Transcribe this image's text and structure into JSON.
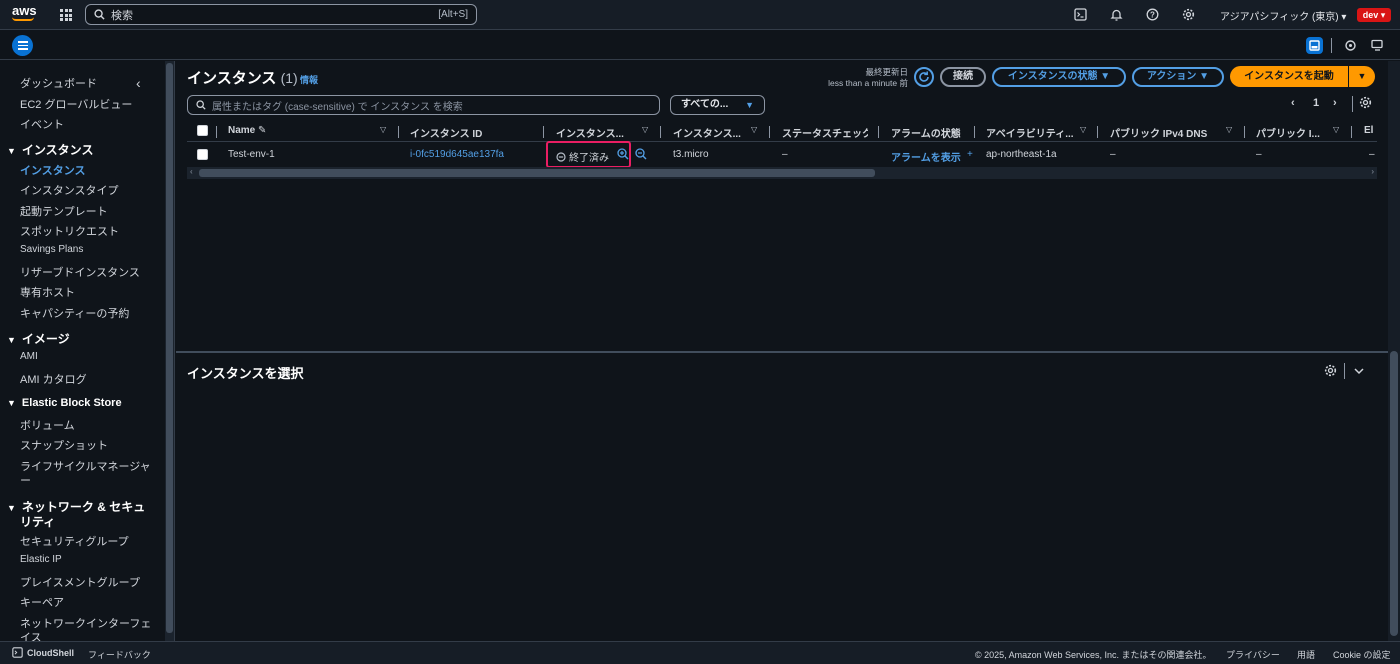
{
  "topnav": {
    "logo": "aws",
    "search_placeholder": "検索",
    "search_shortcut": "[Alt+S]",
    "region": "アジアパシフィック (東京) ▾",
    "env_badge": "dev ▾"
  },
  "sidebar": {
    "items_top": [
      "ダッシュボード",
      "EC2 グローバルビュー",
      "イベント"
    ],
    "section_instances": "インスタンス",
    "instances_items": [
      "インスタンス",
      "インスタンスタイプ",
      "起動テンプレート",
      "スポットリクエスト",
      "Savings Plans",
      "リザーブドインスタンス",
      "専有ホスト",
      "キャパシティーの予約"
    ],
    "section_images": "イメージ",
    "images_items": [
      "AMI",
      "AMI カタログ"
    ],
    "section_ebs": "Elastic Block Store",
    "ebs_items": [
      "ボリューム",
      "スナップショット",
      "ライフサイクルマネージャ",
      "ー"
    ],
    "section_network_1": "ネットワーク & セキュ",
    "section_network_2": "リティ",
    "network_items": [
      "セキュリティグループ",
      "Elastic IP",
      "プレイスメントグループ",
      "キーペア",
      "ネットワークインターフェ",
      "イス"
    ]
  },
  "main": {
    "title": "インスタンス",
    "count": "(1)",
    "info": "情報",
    "last_updated_label": "最終更新日",
    "last_updated_value": "less than a minute 前",
    "connect_button": "接続",
    "instance_state_button": "インスタンスの状態 ▼",
    "actions_button": "アクション ▼",
    "launch_button": "インスタンスを起動",
    "filter_placeholder": "属性またはタグ (case-sensitive) で インスタンス を検索",
    "filter_select": "すべての...",
    "page_number": "1",
    "columns": [
      "Name",
      "インスタンス ID",
      "インスタンス...",
      "インスタンス...",
      "ステータスチェック",
      "アラームの状態",
      "アベイラビリティ...",
      "パブリック IPv4 DNS",
      "パブリック I...",
      "El"
    ],
    "row": {
      "name": "Test-env-1",
      "instance_id": "i-0fc519d645ae137fa",
      "state": "終了済み",
      "type": "t3.micro",
      "status_check": "–",
      "alarm": "アラームを表示",
      "alarm_plus": "+",
      "az": "ap-northeast-1a",
      "public_dns": "–",
      "public_ip": "–",
      "elastic": "–"
    }
  },
  "bottom": {
    "title": "インスタンスを選択"
  },
  "footer": {
    "cloudshell": "CloudShell",
    "feedback": "フィードバック",
    "copyright": "© 2025, Amazon Web Services, Inc. またはその関連会社。",
    "privacy": "プライバシー",
    "terms": "用語",
    "cookie": "Cookie の設定"
  }
}
